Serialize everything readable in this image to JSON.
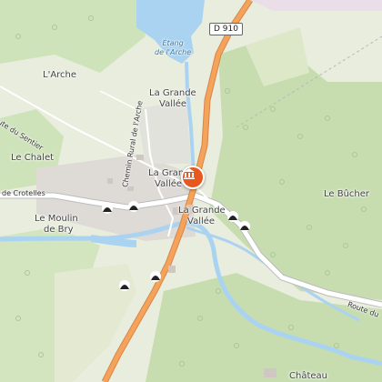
{
  "map": {
    "road_shield": "D 910",
    "place_labels": [
      {
        "id": "arche",
        "text": "L'Arche"
      },
      {
        "id": "grande-vallee-n1",
        "text": "La Grande"
      },
      {
        "id": "grande-vallee-n2",
        "text": "Vallée"
      },
      {
        "id": "grande-vallee-c1",
        "text": "La Grande"
      },
      {
        "id": "grande-vallee-c2",
        "text": "Vallée"
      },
      {
        "id": "grande-vallee-s1",
        "text": "La Grande"
      },
      {
        "id": "grande-vallee-s2",
        "text": "Vallée"
      },
      {
        "id": "chalet",
        "text": "Le Chalet"
      },
      {
        "id": "moulin-1",
        "text": "Le Moulin"
      },
      {
        "id": "moulin-2",
        "text": "de Bry"
      },
      {
        "id": "bucher",
        "text": "Le Bûcher"
      },
      {
        "id": "chateau",
        "text": "Château"
      }
    ],
    "water_label": [
      "Étang",
      "de l'Arche"
    ],
    "road_labels": {
      "sentier": "Route du Sentier",
      "chemin": "Chemin Rural de l'Arche",
      "crotelles": "de Crotelles",
      "route_du": "Route du"
    },
    "poi": {
      "icon": "museum-icon",
      "color": "#e8571e"
    },
    "colors": {
      "forest": "#c9deb2",
      "field": "#e8ecde",
      "water": "#a9d3f0",
      "main_road": "#f5a25a",
      "minor_road": "#ffffff"
    }
  }
}
